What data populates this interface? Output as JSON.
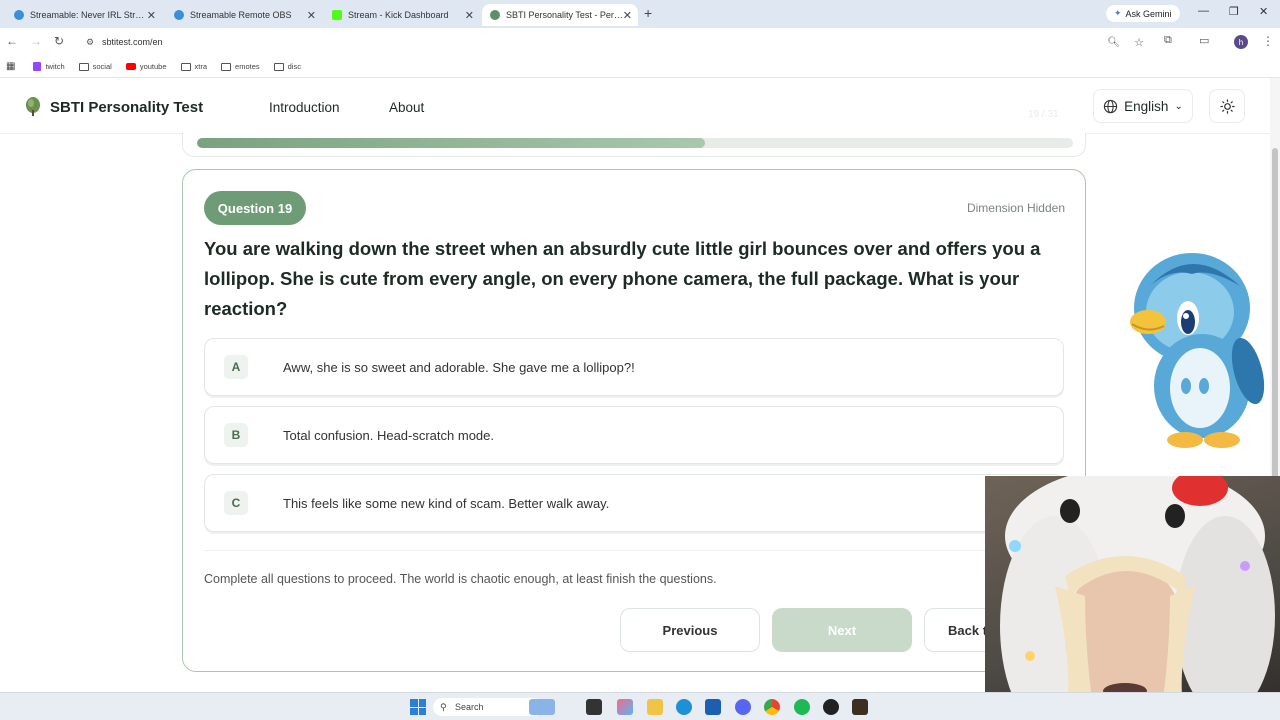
{
  "browser": {
    "tabs": [
      {
        "label": "Streamable: Never IRL Stream W",
        "icon_color": "#3b8fd9"
      },
      {
        "label": "Streamable Remote OBS",
        "icon_color": "#3b8fd9"
      },
      {
        "label": "Stream - Kick Dashboard",
        "icon_color": "#53fc18"
      },
      {
        "label": "SBTI Personality Test - Personali",
        "icon_color": "#5f8f64",
        "active": true
      }
    ],
    "ask_gemini": "Ask Gemini",
    "url": "sbtitest.com/en",
    "bookmarks": [
      "twitch",
      "social",
      "youtube",
      "xtra",
      "emotes",
      "disc"
    ],
    "profile_initial": "h"
  },
  "site": {
    "title": "SBTI Personality Test",
    "nav": {
      "introduction": "Introduction",
      "about": "About"
    },
    "language": "English",
    "counter": "19 / 31"
  },
  "progress": {
    "fraction": 0.58
  },
  "question": {
    "badge": "Question 19",
    "dimension": "Dimension Hidden",
    "text": "You are walking down the street when an absurdly cute little girl bounces over and offers you a lollipop. She is cute from every angle, on every phone camera, the full package. What is your reaction?",
    "options": [
      {
        "key": "A",
        "text": "Aww, she is so sweet and adorable. She gave me a lollipop?!"
      },
      {
        "key": "B",
        "text": "Total confusion. Head-scratch mode."
      },
      {
        "key": "C",
        "text": "This feels like some new kind of scam. Better walk away."
      }
    ],
    "hint": "Complete all questions to proceed. The world is chaotic enough, at least finish the questions.",
    "buttons": {
      "previous": "Previous",
      "next": "Next",
      "back": "Back t"
    }
  },
  "taskbar": {
    "search_placeholder": "Search"
  },
  "colors": {
    "accent": "#6e9c76",
    "border": "#a8c8ae"
  }
}
